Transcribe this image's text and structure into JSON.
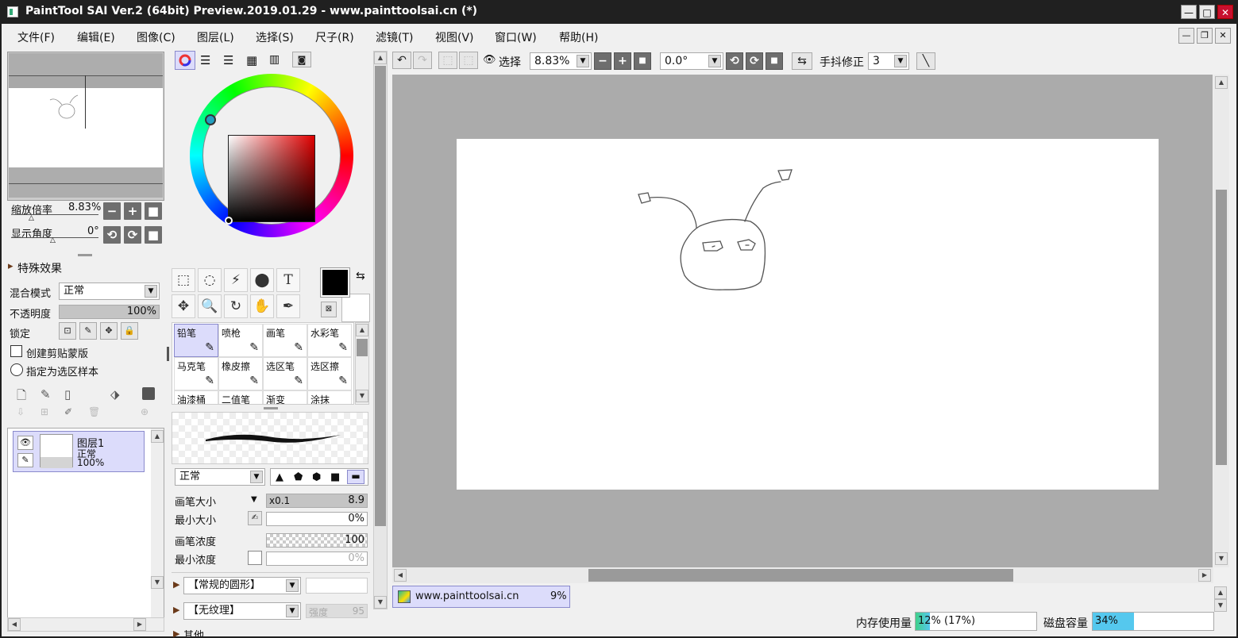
{
  "window": {
    "title": "PaintTool SAI Ver.2 (64bit) Preview.2019.01.29 - www.painttoolsai.cn (*)"
  },
  "menu": [
    "文件(F)",
    "编辑(E)",
    "图像(C)",
    "图层(L)",
    "选择(S)",
    "尺子(R)",
    "滤镜(T)",
    "视图(V)",
    "窗口(W)",
    "帮助(H)"
  ],
  "navigator": {
    "zoom_label": "缩放倍率",
    "zoom_value": "8.83%",
    "angle_label": "显示角度",
    "angle_value": "0°"
  },
  "layer_props": {
    "effects_label": "特殊效果",
    "blend_label": "混合模式",
    "blend_value": "正常",
    "opacity_label": "不透明度",
    "opacity_value": "100%",
    "opacity": 1.0,
    "lock_label": "锁定",
    "clip_label": "创建剪贴蒙版",
    "selsrc_label": "指定为选区样本"
  },
  "layer": {
    "name": "图层1",
    "mode": "正常",
    "opacity": "100%"
  },
  "brushes": [
    [
      "铅笔",
      "喷枪",
      "画笔",
      "水彩笔"
    ],
    [
      "马克笔",
      "橡皮擦",
      "选区笔",
      "选区擦"
    ],
    [
      "油漆桶",
      "二值笔",
      "渐变",
      "涂抹"
    ]
  ],
  "brush_settings": {
    "mode": "正常",
    "size_label": "画笔大小",
    "size_mult": "x0.1",
    "size_value": "8.9",
    "minsize_label": "最小大小",
    "minsize_value": "0%",
    "density_label": "画笔浓度",
    "density_value": "100",
    "mindensity_label": "最小浓度",
    "mindensity_value": "0%",
    "shape": "【常规的圆形】",
    "texture": "【无纹理】",
    "strength_label": "强度",
    "strength_value": "95",
    "other_label": "其他"
  },
  "toolbar": {
    "select_label": "选择",
    "zoom": "8.83%",
    "angle": "0.0°",
    "stabilizer_label": "手抖修正",
    "stabilizer": "3"
  },
  "doc_tab": {
    "name": "www.painttoolsai.cn",
    "zoom": "9%"
  },
  "status": {
    "mem_label": "内存使用量",
    "mem_value": "12% (17%)",
    "mem": 0.12,
    "disk_label": "磁盘容量",
    "disk_value": "34%",
    "disk": 0.34
  },
  "colors": {
    "accent": "#dcdcfb",
    "canvas_bg": "#ababab",
    "primary": "#000000",
    "mem_bar": "#3fd08a",
    "disk_bar": "#55c8ee"
  }
}
